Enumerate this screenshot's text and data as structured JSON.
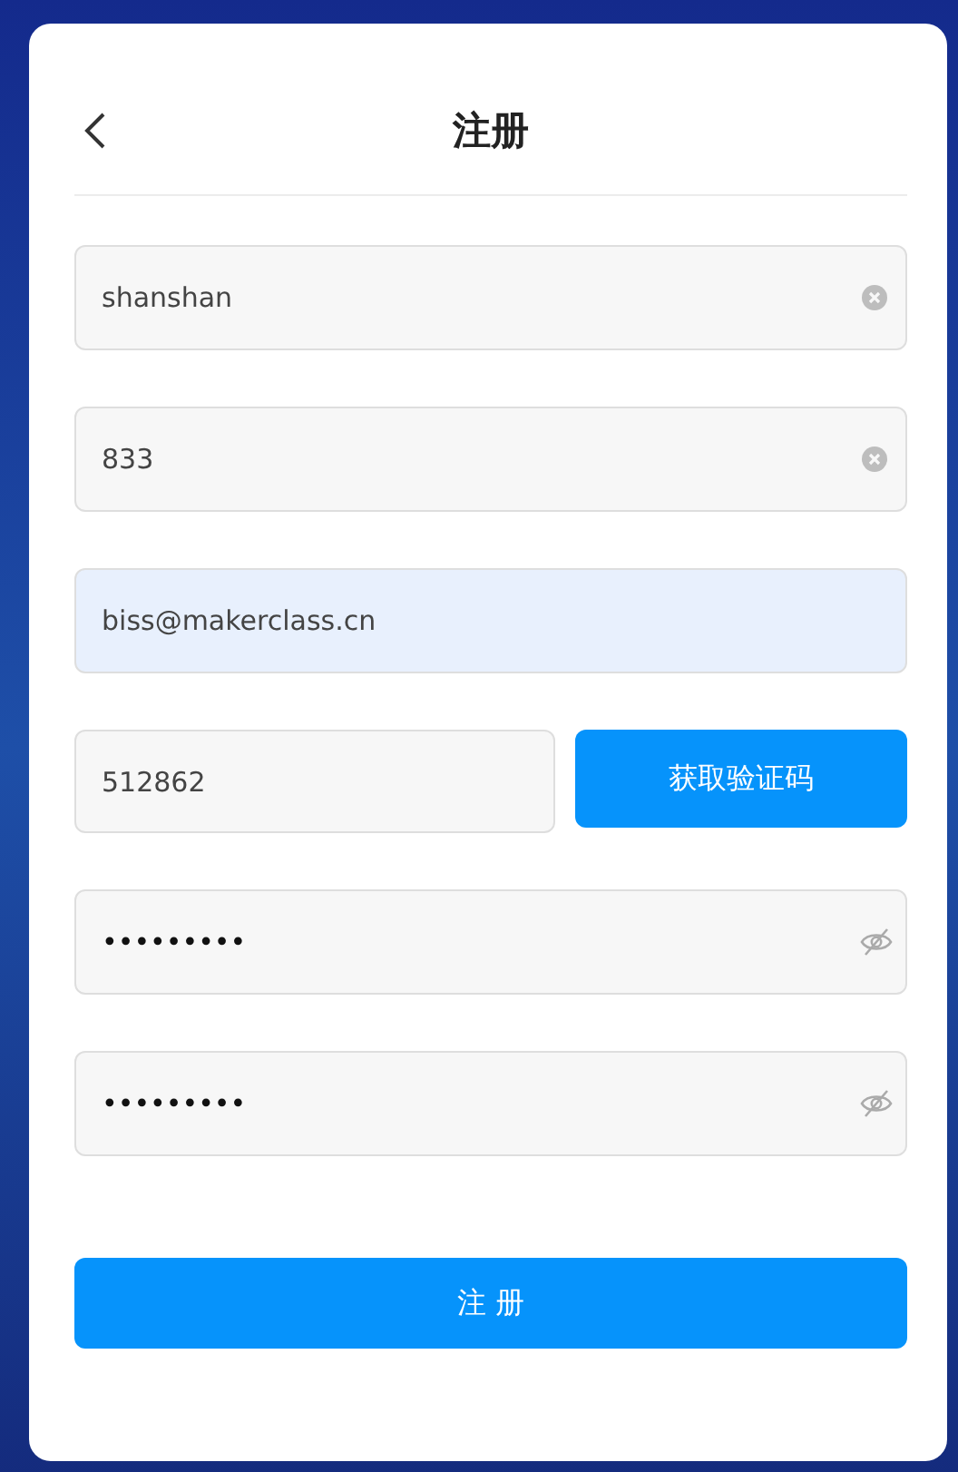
{
  "header": {
    "title": "注册"
  },
  "fields": [
    {
      "kind": "clearable",
      "value": "shanshan",
      "autofilled": false
    },
    {
      "kind": "clearable",
      "value": "833",
      "autofilled": false
    },
    {
      "kind": "plain",
      "value": "biss@makerclass.cn",
      "autofilled": true
    },
    {
      "kind": "code",
      "value": "512862",
      "autofilled": false,
      "button": "获取验证码"
    },
    {
      "kind": "password",
      "value": "•••••••••",
      "autofilled": false
    },
    {
      "kind": "password",
      "value": "•••••••••",
      "autofilled": false
    }
  ],
  "submit": "注 册"
}
